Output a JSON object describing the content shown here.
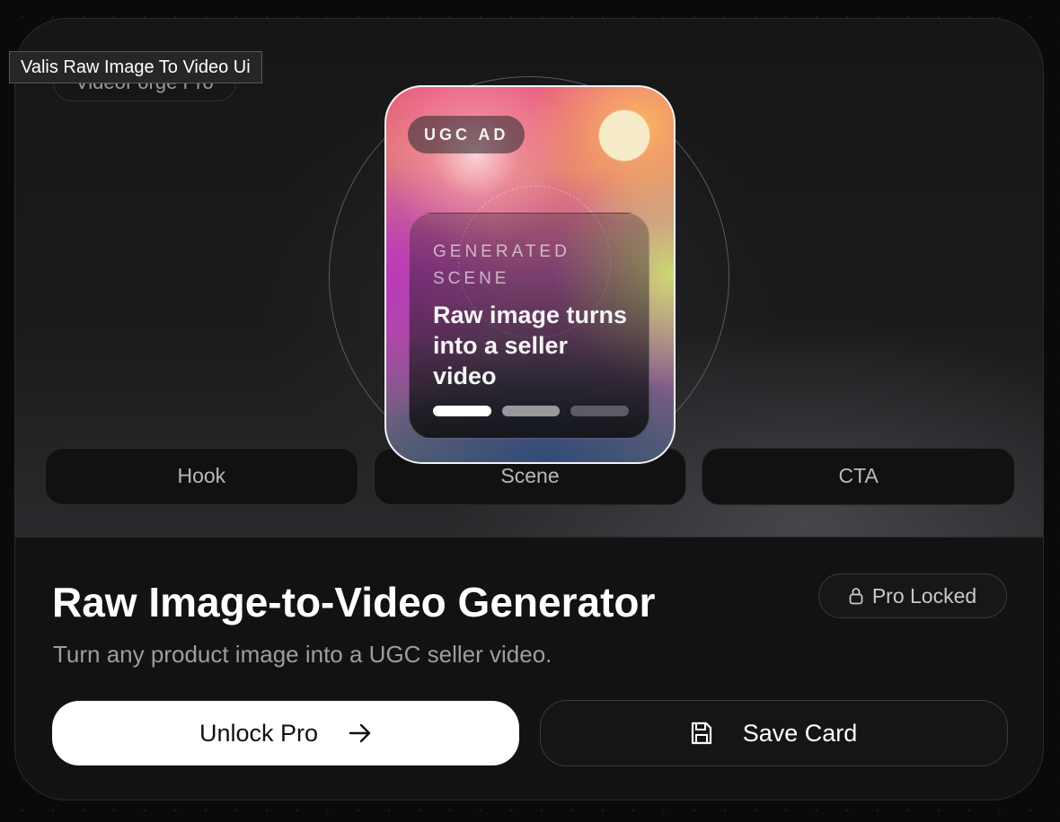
{
  "tooltip": {
    "text": "Valis Raw Image To Video Ui"
  },
  "brand": {
    "name": "VideoForge Pro"
  },
  "preview": {
    "badge": "UGC AD",
    "scene_eyebrow": "GENERATED SCENE",
    "scene_title": "Raw image turns into a seller video",
    "progress_segments": 3,
    "active_segment": 1
  },
  "steps": [
    {
      "label": "Hook"
    },
    {
      "label": "Scene"
    },
    {
      "label": "CTA"
    }
  ],
  "main": {
    "title": "Raw Image-to-Video Generator",
    "subtitle": "Turn any product image into a UGC seller video.",
    "lock_badge": "Pro Locked"
  },
  "actions": {
    "unlock_label": "Unlock Pro",
    "save_label": "Save Card"
  },
  "icons": {
    "lock": "lock-icon",
    "arrow": "arrow-right-icon",
    "save": "floppy-disk-icon"
  },
  "colors": {
    "background": "#0a0a0b",
    "card": "#121213",
    "primary_button": "#ffffff",
    "status_dot": "#f6ecc8"
  }
}
